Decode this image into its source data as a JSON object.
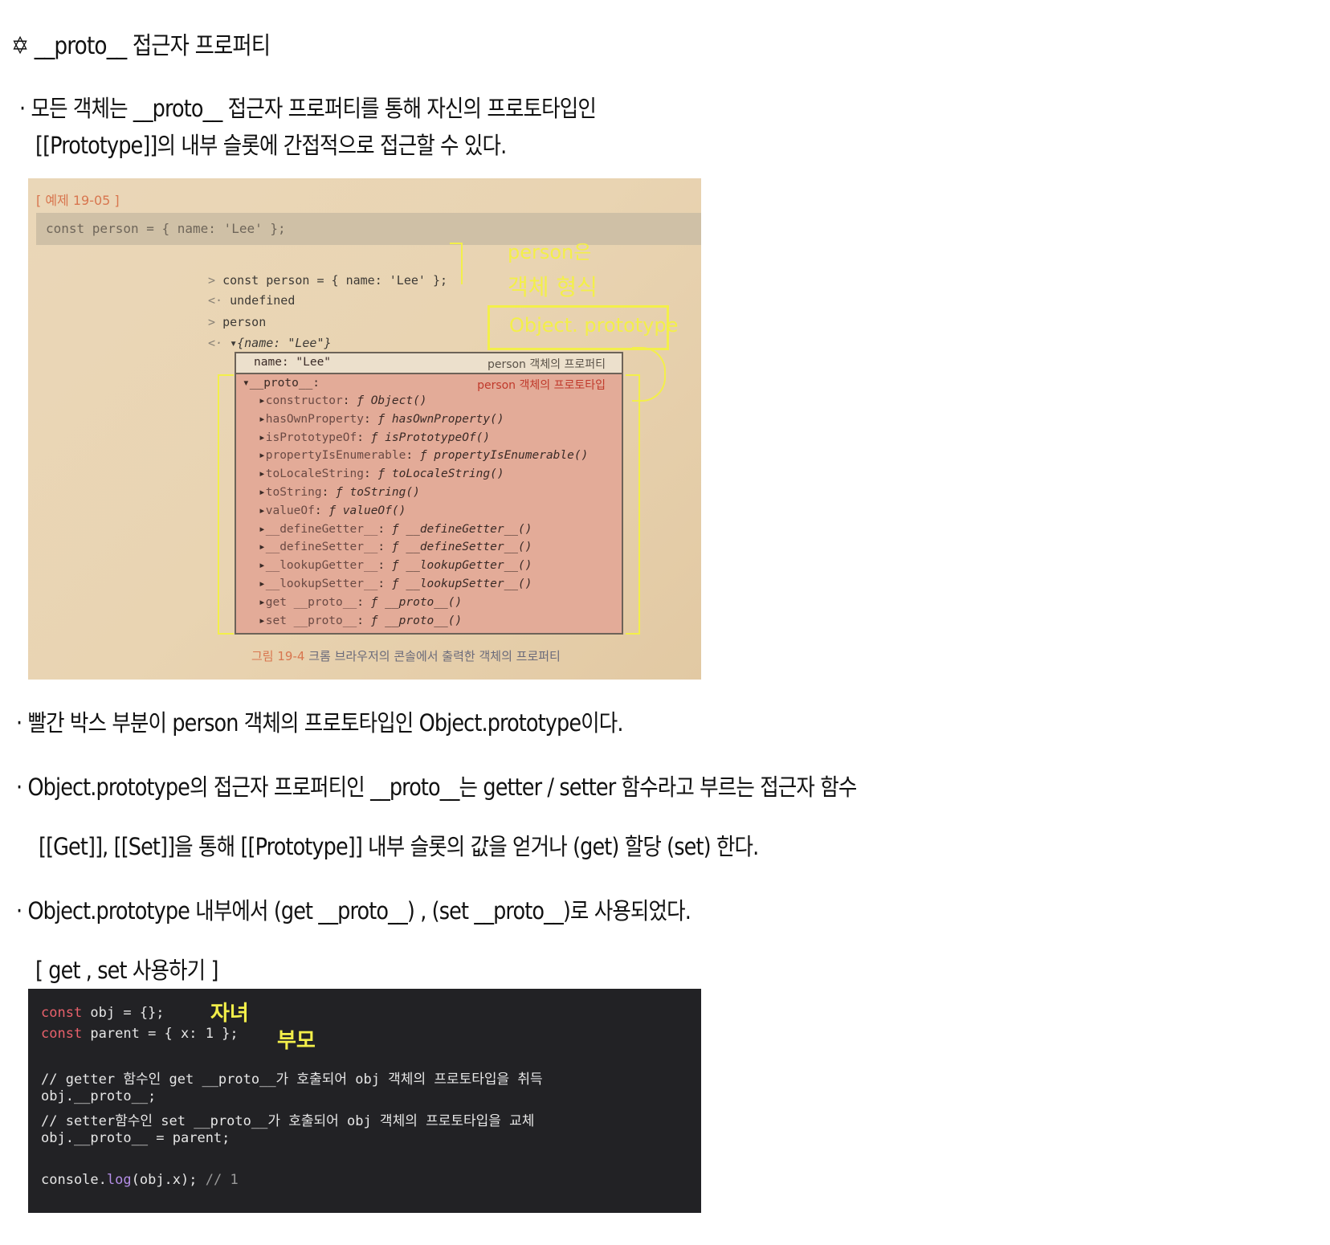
{
  "title": {
    "icon": "star-icon",
    "text": "__proto__ 접근자 프로퍼티"
  },
  "intro": {
    "line1": "· 모든 객체는 __proto__ 접근자 프로퍼티를 통해 자신의 프로토타입인",
    "line2": "[[Prototype]]의 내부 슬롯에 간접적으로 접근할 수 있다."
  },
  "photo": {
    "example_label": "[ 예제 19-05 ]",
    "code": "const person = { name: 'Lee' };",
    "console": [
      {
        "prompt": ">",
        "text": "const person = { name: 'Lee' };"
      },
      {
        "prompt": "<·",
        "text": "undefined"
      },
      {
        "prompt": ">",
        "text": "person"
      },
      {
        "prompt": "<·",
        "text": "▾{name: \"Lee\"}"
      }
    ],
    "name_row": "name: \"Lee\"",
    "name_note": "person 객체의 프로퍼티",
    "proto_row": "▾__proto__:",
    "proto_note": "person 객체의 프로토타입",
    "proto_items": [
      {
        "key": "constructor",
        "val": "Object()"
      },
      {
        "key": "hasOwnProperty",
        "val": "hasOwnProperty()"
      },
      {
        "key": "isPrototypeOf",
        "val": "isPrototypeOf()"
      },
      {
        "key": "propertyIsEnumerable",
        "val": "propertyIsEnumerable()"
      },
      {
        "key": "toLocaleString",
        "val": "toLocaleString()"
      },
      {
        "key": "toString",
        "val": "toString()"
      },
      {
        "key": "valueOf",
        "val": "valueOf()"
      },
      {
        "key": "__defineGetter__",
        "val": "__defineGetter__()"
      },
      {
        "key": "__defineSetter__",
        "val": "__defineSetter__()"
      },
      {
        "key": "__lookupGetter__",
        "val": "__lookupGetter__()"
      },
      {
        "key": "__lookupSetter__",
        "val": "__lookupSetter__()"
      },
      {
        "key": "get __proto__",
        "val": "__proto__()"
      },
      {
        "key": "set __proto__",
        "val": "__proto__()"
      }
    ],
    "figure_number": "그림 19-4",
    "figure_caption": "크롬 브라우저의 콘솔에서 출력한 객체의 프로퍼티",
    "annotations": {
      "line1": "person은",
      "line2": "객체 형식",
      "boxed": "Object. prototype"
    }
  },
  "bullets": [
    "· 빨간 박스 부분이  person 객체의 프로토타입인  Object.prototype이다.",
    "· Object.prototype의 접근자 프로퍼티인 __proto__는 getter / setter 함수라고 부르는 접근자 함수",
    "[[Get]], [[Set]]을 통해 [[Prototype]] 내부 슬롯의 값을 얻거나 (get) 할당 (set) 한다.",
    "· Object.prototype 내부에서 (get __proto__) , (set __proto__)로 사용되었다.",
    "[ get , set 사용하기 ]"
  ],
  "code": {
    "line1_kw": "const",
    "line1": " obj = {};",
    "line2_kw": "const",
    "line2": " parent = { x: 1 };",
    "comment1": "// getter 함수인 get __proto__가 호출되어 obj 객체의 프로토타입을 취득",
    "line3": "obj.__proto__;",
    "comment2": "// setter함수인 set __proto__가 호출되어 obj 객체의 프로토타입을 교체",
    "line4": "obj.__proto__ = parent;",
    "line5a": "console.",
    "line5_fn": "log",
    "line5b": "(obj.x); ",
    "line5_cm": "// 1",
    "annot_child": "자녀",
    "annot_parent": "부모"
  },
  "colors": {
    "annotation": "#f3ef4a",
    "keyword": "#e8616b",
    "code_bg": "#222225",
    "proto_box": "#e3ab98"
  }
}
